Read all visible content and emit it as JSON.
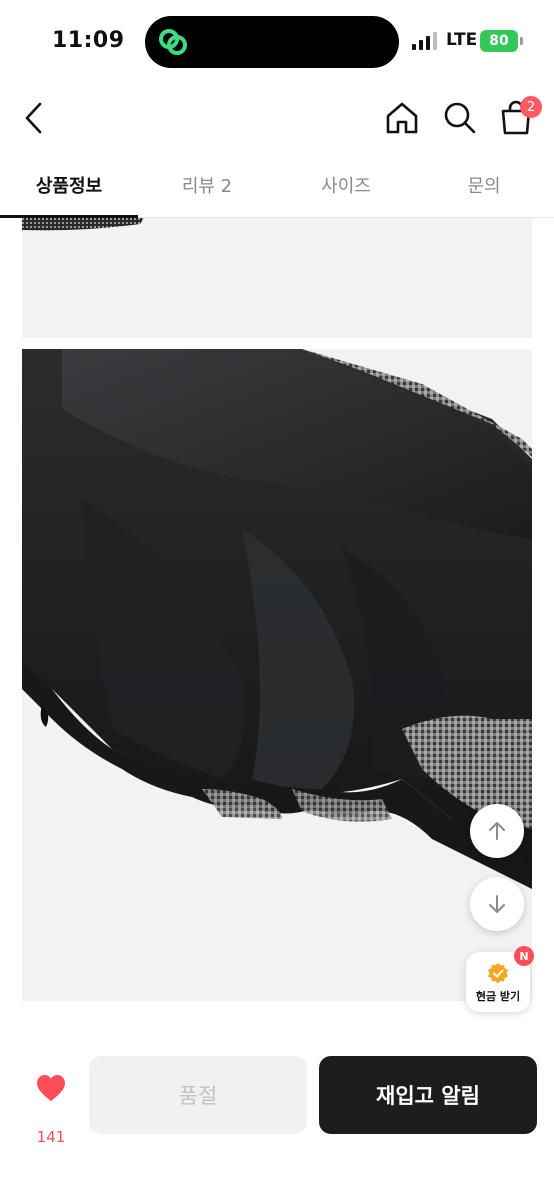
{
  "status_bar": {
    "time": "11:09",
    "network": "LTE",
    "battery": "80"
  },
  "header": {
    "back_icon": "chevron-left-icon",
    "home_icon": "home-icon",
    "search_icon": "search-icon",
    "cart_icon": "shopping-bag-icon",
    "cart_badge": "2"
  },
  "tabs": [
    {
      "label": "상품정보",
      "active": true
    },
    {
      "label": "리뷰 2",
      "active": false
    },
    {
      "label": "사이즈",
      "active": false
    },
    {
      "label": "문의",
      "active": false
    }
  ],
  "floating": {
    "up_icon": "arrow-up-icon",
    "down_icon": "arrow-down-icon",
    "cash_label": "현금 받기",
    "cash_badge": "N"
  },
  "bottom_bar": {
    "like_count": "141",
    "soldout_label": "품절",
    "restock_label": "재입고 알림"
  },
  "colors": {
    "accent_red": "#ff4d5a",
    "dark_button": "#1d1d1d",
    "battery_green": "#34c759"
  }
}
